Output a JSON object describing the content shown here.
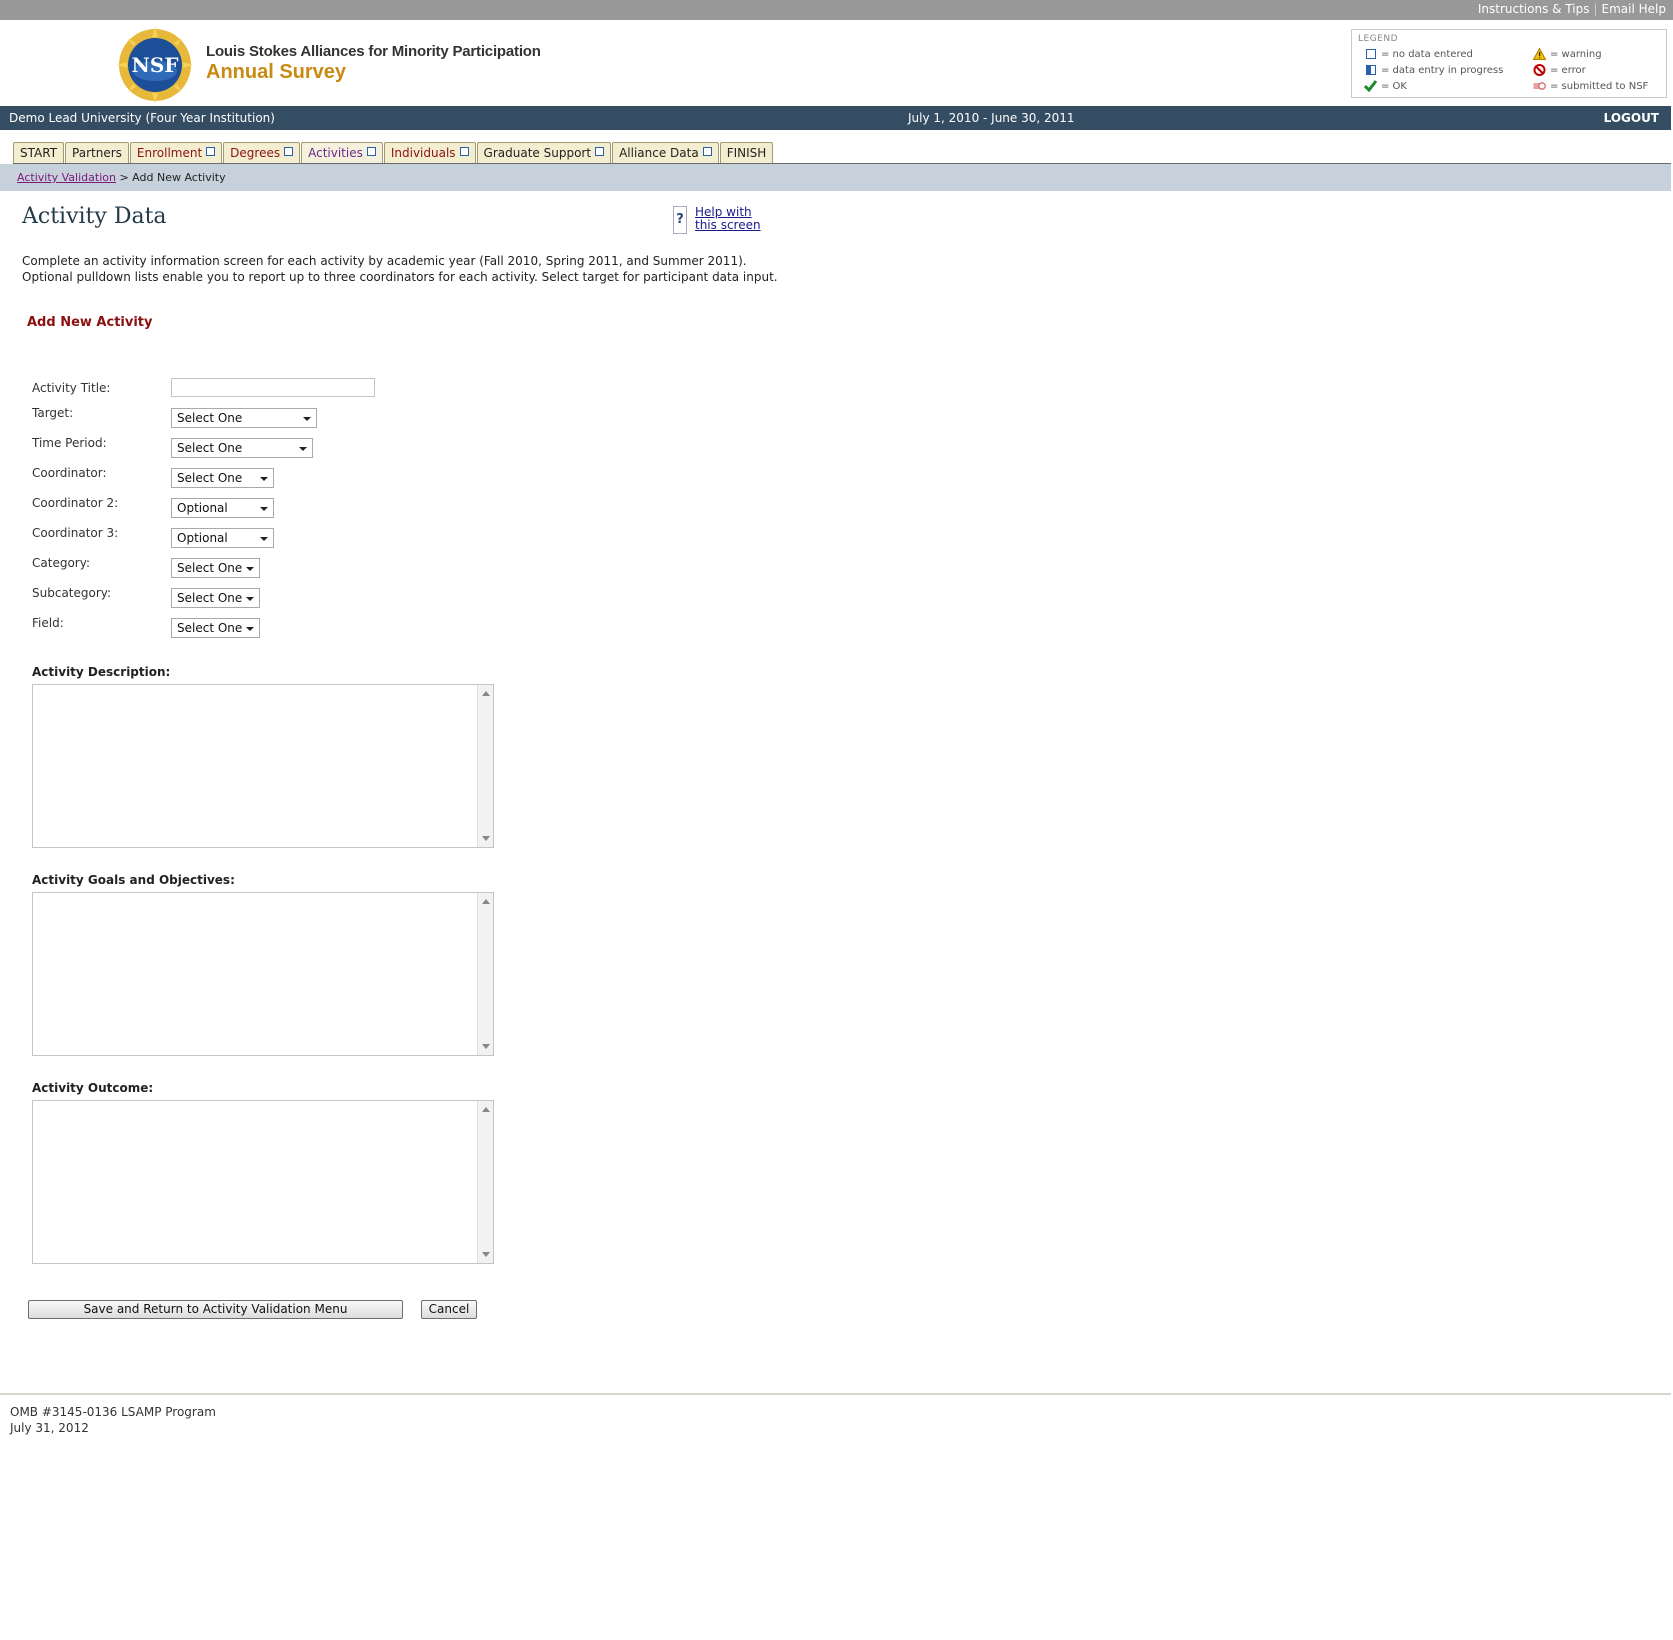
{
  "top_links": {
    "instructions": "Instructions & Tips",
    "separator": "|",
    "email": "Email Help"
  },
  "header": {
    "logo_text": "NSF",
    "program_line": "Louis Stokes Alliances for Minority Participation",
    "survey_name": "Annual Survey"
  },
  "legend": {
    "title": "LEGEND",
    "items": [
      {
        "icon": "empty-box-icon",
        "label": "= no data entered"
      },
      {
        "icon": "half-filled-box-icon",
        "label": "= data entry in progress"
      },
      {
        "icon": "checkmark-icon",
        "label": "= OK"
      },
      {
        "icon": "warning-icon",
        "label": "= warning"
      },
      {
        "icon": "error-icon",
        "label": "= error"
      },
      {
        "icon": "submitted-icon",
        "label": "= submitted to NSF"
      }
    ]
  },
  "info_bar": {
    "institution": "Demo Lead University (Four Year Institution)",
    "period": "July 1, 2010 - June 30, 2011",
    "logout": "LOGOUT"
  },
  "tabs": [
    {
      "label": "START",
      "status": "none"
    },
    {
      "label": "Partners",
      "status": "none"
    },
    {
      "label": "Enrollment",
      "status": "empty"
    },
    {
      "label": "Degrees",
      "status": "empty"
    },
    {
      "label": "Activities",
      "status": "empty"
    },
    {
      "label": "Individuals",
      "status": "empty"
    },
    {
      "label": "Graduate Support",
      "status": "empty"
    },
    {
      "label": "Alliance Data",
      "status": "empty"
    },
    {
      "label": "FINISH",
      "status": "none"
    }
  ],
  "breadcrumb": {
    "link": "Activity Validation",
    "separator": ">",
    "current": "Add New Activity"
  },
  "page": {
    "title": "Activity Data",
    "help_line1": "Help with",
    "help_line2": "this screen",
    "help_icon": "?",
    "intro_line1": "Complete an activity information screen for each activity by academic year (Fall 2010, Spring 2011, and Summer 2011).",
    "intro_line2": "Optional pulldown lists enable you to report up to three coordinators for each activity. Select target for participant data input.",
    "section_title": "Add New Activity"
  },
  "form": {
    "activity_title": {
      "label": "Activity Title:",
      "value": ""
    },
    "target": {
      "label": "Target:",
      "value": "Select One"
    },
    "time_period": {
      "label": "Time Period:",
      "value": "Select One"
    },
    "coordinator": {
      "label": "Coordinator:",
      "value": "Select One"
    },
    "coordinator2": {
      "label": "Coordinator 2:",
      "value": "Optional"
    },
    "coordinator3": {
      "label": "Coordinator 3:",
      "value": "Optional"
    },
    "category": {
      "label": "Category:",
      "value": "Select One"
    },
    "subcategory": {
      "label": "Subcategory:",
      "value": "Select One"
    },
    "field": {
      "label": "Field:",
      "value": "Select One"
    },
    "description": {
      "label": "Activity Description:",
      "value": ""
    },
    "goals": {
      "label": "Activity Goals and Objectives:",
      "value": ""
    },
    "outcome": {
      "label": "Activity Outcome:",
      "value": ""
    }
  },
  "buttons": {
    "save": "Save and Return to Activity Validation Menu",
    "cancel": "Cancel"
  },
  "footer": {
    "line1": "OMB #3145-0136 LSAMP Program",
    "line2": "July 31, 2012"
  },
  "colors": {
    "info_bar": "#344d62",
    "accent_red": "#8b1010",
    "survey_gold": "#c88a12",
    "breadcrumb_bg": "#c7d1db"
  }
}
